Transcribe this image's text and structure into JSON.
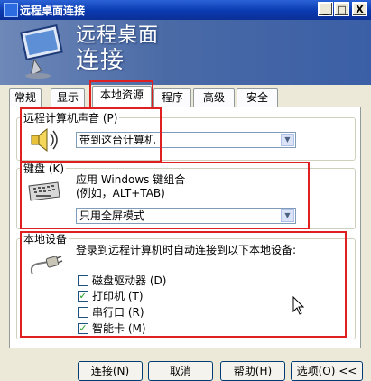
{
  "window": {
    "title": "远程桌面连接",
    "controls": {
      "minimize": "_",
      "maximize": "□",
      "close": "X"
    }
  },
  "banner": {
    "line1": "远程桌面",
    "line2": "连接"
  },
  "tabs": [
    {
      "label": "常规",
      "active": false
    },
    {
      "label": "显示",
      "active": false
    },
    {
      "label": "本地资源",
      "active": true
    },
    {
      "label": "程序",
      "active": false
    },
    {
      "label": "高级",
      "active": false
    },
    {
      "label": "安全",
      "active": false
    }
  ],
  "sound": {
    "title": "远程计算机声音 (P)",
    "icon": "speaker-icon",
    "selected": "带到这台计算机"
  },
  "keyboard": {
    "title": "键盘 (K)",
    "icon": "keyboard-icon",
    "desc_line1": "应用 Windows 键组合",
    "desc_line2": "(例如，ALT+TAB)",
    "selected": "只用全屏模式"
  },
  "devices": {
    "title": "本地设备",
    "icon": "plug-icon",
    "desc": "登录到远程计算机时自动连接到以下本地设备:",
    "items": [
      {
        "label": "磁盘驱动器 (D)",
        "checked": false
      },
      {
        "label": "打印机 (T)",
        "checked": true
      },
      {
        "label": "串行口 (R)",
        "checked": false
      },
      {
        "label": "智能卡 (M)",
        "checked": true
      }
    ]
  },
  "buttons": {
    "connect": "连接(N)",
    "cancel": "取消",
    "help": "帮助(H)",
    "options": "选项(O) <<"
  },
  "colors": {
    "highlight_box": "#e02020",
    "title_bar": "#0a3ab0"
  }
}
